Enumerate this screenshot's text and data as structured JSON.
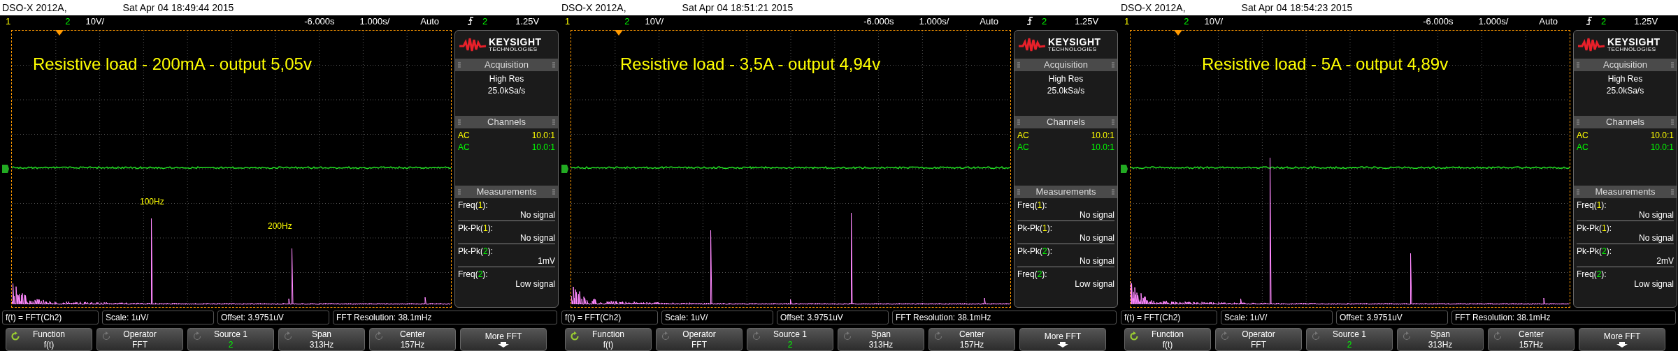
{
  "panels": [
    {
      "header": {
        "model": "DSO-X 2012A,",
        "timestamp": "Sat Apr 04 18:49:44 2015"
      },
      "status": {
        "channel_1": "1",
        "channel_2": "2",
        "channel_2_scale": "10V/",
        "time_offset": "-6.000s",
        "time_scale": "1.000s/",
        "trigger_mode": "Auto",
        "trigger_source": "2",
        "trigger_level": "1.25V"
      },
      "annotations": [
        {
          "kind": "title",
          "text": "Resistive load - 200mA - output 5,05v"
        },
        {
          "kind": "marker",
          "text": "100Hz"
        },
        {
          "kind": "marker",
          "text": "200Hz"
        }
      ],
      "side_panel": {
        "logo": {
          "brand": "KEYSIGHT",
          "subtitle": "TECHNOLOGIES"
        },
        "acquisition": {
          "title": "Acquisition",
          "mode": "High Res",
          "rate": "25.0kSa/s"
        },
        "channels": {
          "title": "Channels",
          "rows": [
            {
              "coupling": "AC",
              "probe": "10.0:1",
              "color": "#ffff00"
            },
            {
              "coupling": "AC",
              "probe": "10.0:1",
              "color": "#00ff00"
            }
          ]
        },
        "measurements": {
          "title": "Measurements",
          "rows": [
            {
              "prefix": "Freq(",
              "channel": "1",
              "suffix": "):",
              "value": "No signal",
              "color": "#ffff00"
            },
            {
              "prefix": "Pk-Pk(",
              "channel": "1",
              "suffix": "):",
              "value": "No signal",
              "color": "#ffff00"
            },
            {
              "prefix": "Pk-Pk(",
              "channel": "2",
              "suffix": "):",
              "value": "1mV",
              "color": "#00ff00"
            },
            {
              "prefix": "Freq(",
              "channel": "2",
              "suffix": "):",
              "value": "Low signal",
              "color": "#00ff00"
            }
          ]
        }
      },
      "info_bar": [
        "f(t) = FFT(Ch2)",
        "Scale: 1uV/",
        "Offset: 3.9751uV",
        "FFT Resolution: 38.1mHz"
      ],
      "softkeys": [
        {
          "kind": "knob",
          "label": "Function",
          "value": "f(t)",
          "selected": true,
          "color": "#ffffff"
        },
        {
          "kind": "knob",
          "label": "Operator",
          "value": "FFT",
          "selected": false,
          "color": "#ffffff"
        },
        {
          "kind": "knob",
          "label": "Source 1",
          "value": "2",
          "selected": false,
          "color": "#00ff00"
        },
        {
          "kind": "knob",
          "label": "Span",
          "value": "313Hz",
          "selected": false,
          "color": "#ffffff"
        },
        {
          "kind": "knob",
          "label": "Center",
          "value": "157Hz",
          "selected": false,
          "color": "#ffffff"
        },
        {
          "kind": "more",
          "label": "More FFT"
        }
      ]
    },
    {
      "header": {
        "model": "DSO-X 2012A,",
        "timestamp": "Sat Apr 04 18:51:21 2015"
      },
      "status": {
        "channel_1": "1",
        "channel_2": "2",
        "channel_2_scale": "10V/",
        "time_offset": "-6.000s",
        "time_scale": "1.000s/",
        "trigger_mode": "Auto",
        "trigger_source": "2",
        "trigger_level": "1.25V"
      },
      "annotations": [
        {
          "kind": "title",
          "text": "Resistive load - 3,5A - output 4,94v"
        }
      ],
      "side_panel": {
        "logo": {
          "brand": "KEYSIGHT",
          "subtitle": "TECHNOLOGIES"
        },
        "acquisition": {
          "title": "Acquisition",
          "mode": "High Res",
          "rate": "25.0kSa/s"
        },
        "channels": {
          "title": "Channels",
          "rows": [
            {
              "coupling": "AC",
              "probe": "10.0:1",
              "color": "#ffff00"
            },
            {
              "coupling": "AC",
              "probe": "10.0:1",
              "color": "#00ff00"
            }
          ]
        },
        "measurements": {
          "title": "Measurements",
          "rows": [
            {
              "prefix": "Freq(",
              "channel": "1",
              "suffix": "):",
              "value": "No signal",
              "color": "#ffff00"
            },
            {
              "prefix": "Pk-Pk(",
              "channel": "1",
              "suffix": "):",
              "value": "No signal",
              "color": "#ffff00"
            },
            {
              "prefix": "Pk-Pk(",
              "channel": "2",
              "suffix": "):",
              "value": "No signal",
              "color": "#00ff00"
            },
            {
              "prefix": "Freq(",
              "channel": "2",
              "suffix": "):",
              "value": "Low signal",
              "color": "#00ff00"
            }
          ]
        }
      },
      "info_bar": [
        "f(t) = FFT(Ch2)",
        "Scale: 1uV/",
        "Offset: 3.9751uV",
        "FFT Resolution: 38.1mHz"
      ],
      "softkeys": [
        {
          "kind": "knob",
          "label": "Function",
          "value": "f(t)",
          "selected": true,
          "color": "#ffffff"
        },
        {
          "kind": "knob",
          "label": "Operator",
          "value": "FFT",
          "selected": false,
          "color": "#ffffff"
        },
        {
          "kind": "knob",
          "label": "Source 1",
          "value": "2",
          "selected": false,
          "color": "#00ff00"
        },
        {
          "kind": "knob",
          "label": "Span",
          "value": "313Hz",
          "selected": false,
          "color": "#ffffff"
        },
        {
          "kind": "knob",
          "label": "Center",
          "value": "157Hz",
          "selected": false,
          "color": "#ffffff"
        },
        {
          "kind": "more",
          "label": "More FFT"
        }
      ]
    },
    {
      "header": {
        "model": "DSO-X 2012A,",
        "timestamp": "Sat Apr 04 18:54:23 2015"
      },
      "status": {
        "channel_1": "1",
        "channel_2": "2",
        "channel_2_scale": "10V/",
        "time_offset": "-6.000s",
        "time_scale": "1.000s/",
        "trigger_mode": "Auto",
        "trigger_source": "2",
        "trigger_level": "1.25V"
      },
      "annotations": [
        {
          "kind": "title",
          "text": "Resistive load - 5A - output 4,89v"
        }
      ],
      "side_panel": {
        "logo": {
          "brand": "KEYSIGHT",
          "subtitle": "TECHNOLOGIES"
        },
        "acquisition": {
          "title": "Acquisition",
          "mode": "High Res",
          "rate": "25.0kSa/s"
        },
        "channels": {
          "title": "Channels",
          "rows": [
            {
              "coupling": "AC",
              "probe": "10.0:1",
              "color": "#ffff00"
            },
            {
              "coupling": "AC",
              "probe": "10.0:1",
              "color": "#00ff00"
            }
          ]
        },
        "measurements": {
          "title": "Measurements",
          "rows": [
            {
              "prefix": "Freq(",
              "channel": "1",
              "suffix": "):",
              "value": "No signal",
              "color": "#ffff00"
            },
            {
              "prefix": "Pk-Pk(",
              "channel": "1",
              "suffix": "):",
              "value": "No signal",
              "color": "#ffff00"
            },
            {
              "prefix": "Pk-Pk(",
              "channel": "2",
              "suffix": "):",
              "value": "2mV",
              "color": "#00ff00"
            },
            {
              "prefix": "Freq(",
              "channel": "2",
              "suffix": "):",
              "value": "Low signal",
              "color": "#00ff00"
            }
          ]
        }
      },
      "info_bar": [
        "f(t) = FFT(Ch2)",
        "Scale: 1uV/",
        "Offset: 3.9751uV",
        "FFT Resolution: 38.1mHz"
      ],
      "softkeys": [
        {
          "kind": "knob",
          "label": "Function",
          "value": "f(t)",
          "selected": true,
          "color": "#ffffff"
        },
        {
          "kind": "knob",
          "label": "Operator",
          "value": "FFT",
          "selected": false,
          "color": "#ffffff"
        },
        {
          "kind": "knob",
          "label": "Source 1",
          "value": "2",
          "selected": false,
          "color": "#00ff00"
        },
        {
          "kind": "knob",
          "label": "Span",
          "value": "313Hz",
          "selected": false,
          "color": "#ffffff"
        },
        {
          "kind": "knob",
          "label": "Center",
          "value": "157Hz",
          "selected": false,
          "color": "#ffffff"
        },
        {
          "kind": "more",
          "label": "More FFT"
        }
      ]
    }
  ]
}
